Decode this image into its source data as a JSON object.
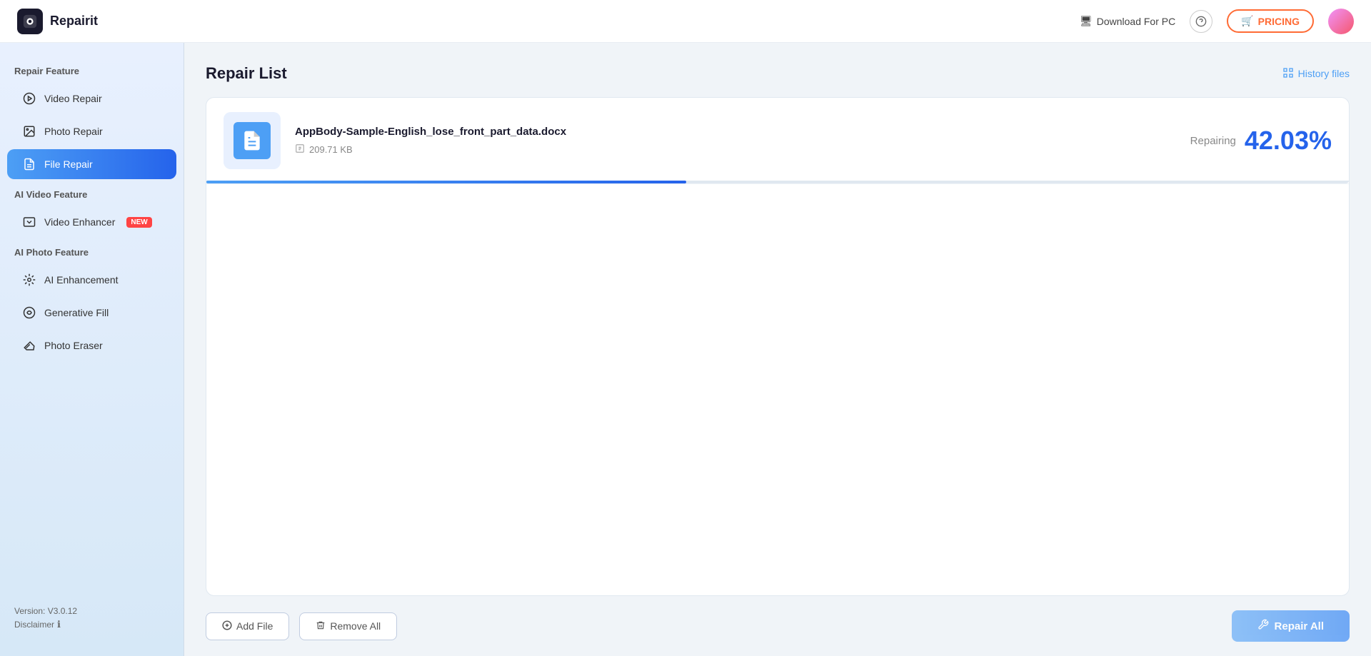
{
  "app": {
    "name": "Repairit",
    "logo_char": "🔧"
  },
  "topbar": {
    "download_label": "Download For PC",
    "help_icon": "❓",
    "pricing_label": "PRICING",
    "pricing_icon": "🛒"
  },
  "sidebar": {
    "section_repair": "Repair Feature",
    "item_video_repair": "Video Repair",
    "item_photo_repair": "Photo Repair",
    "item_file_repair": "File Repair",
    "section_ai_video": "AI Video Feature",
    "item_video_enhancer": "Video Enhancer",
    "new_badge": "NEW",
    "section_ai_photo": "AI Photo Feature",
    "item_ai_enhancement": "AI Enhancement",
    "item_generative_fill": "Generative Fill",
    "item_photo_eraser": "Photo Eraser",
    "version_text": "Version: V3.0.12",
    "disclaimer_label": "Disclaimer"
  },
  "content": {
    "page_title": "Repair List",
    "history_label": "History files"
  },
  "repair_item": {
    "file_name": "AppBody-Sample-English_lose_front_part_data.docx",
    "file_size": "209.71 KB",
    "status_label": "Repairing",
    "percent": "42.03%",
    "progress_value": 42
  },
  "bottom_bar": {
    "add_file_label": "Add File",
    "remove_all_label": "Remove All",
    "repair_all_label": "Repair All"
  }
}
